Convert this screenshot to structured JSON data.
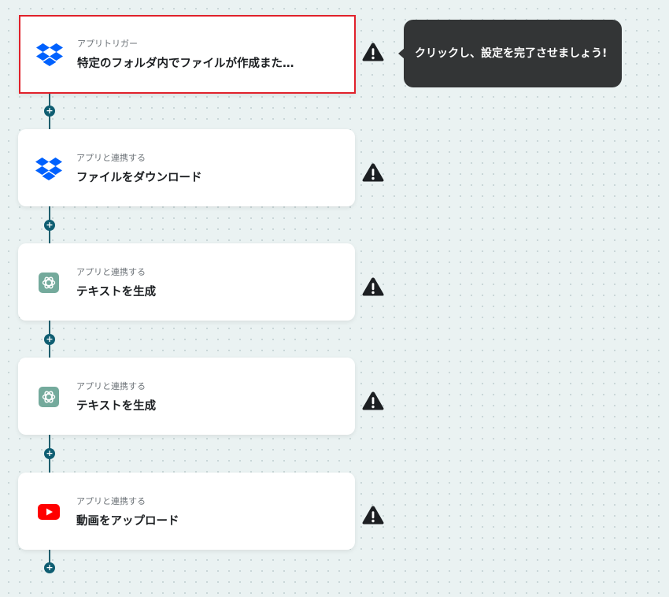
{
  "workflow": {
    "steps": [
      {
        "subtitle": "アプリトリガー",
        "title": "特定のフォルダ内でファイルが作成また…",
        "app_icon": "dropbox-icon",
        "selected": true
      },
      {
        "subtitle": "アプリと連携する",
        "title": "ファイルをダウンロード",
        "app_icon": "dropbox-icon",
        "selected": false
      },
      {
        "subtitle": "アプリと連携する",
        "title": "テキストを生成",
        "app_icon": "chatgpt-icon",
        "selected": false
      },
      {
        "subtitle": "アプリと連携する",
        "title": "テキストを生成",
        "app_icon": "chatgpt-icon",
        "selected": false
      },
      {
        "subtitle": "アプリと連携する",
        "title": "動画をアップロード",
        "app_icon": "youtube-icon",
        "selected": false
      }
    ],
    "add_step_symbol": "+",
    "warning_icon": "warning-icon"
  },
  "tooltip": {
    "text": "クリックし、設定を完了させましょう!"
  },
  "colors": {
    "dropbox": "#0061fe",
    "chatgpt": "#74aa9c",
    "youtube": "#ff0000",
    "selected_border": "#e0212b",
    "connector": "#0f5e72",
    "tooltip_bg": "#333536"
  }
}
